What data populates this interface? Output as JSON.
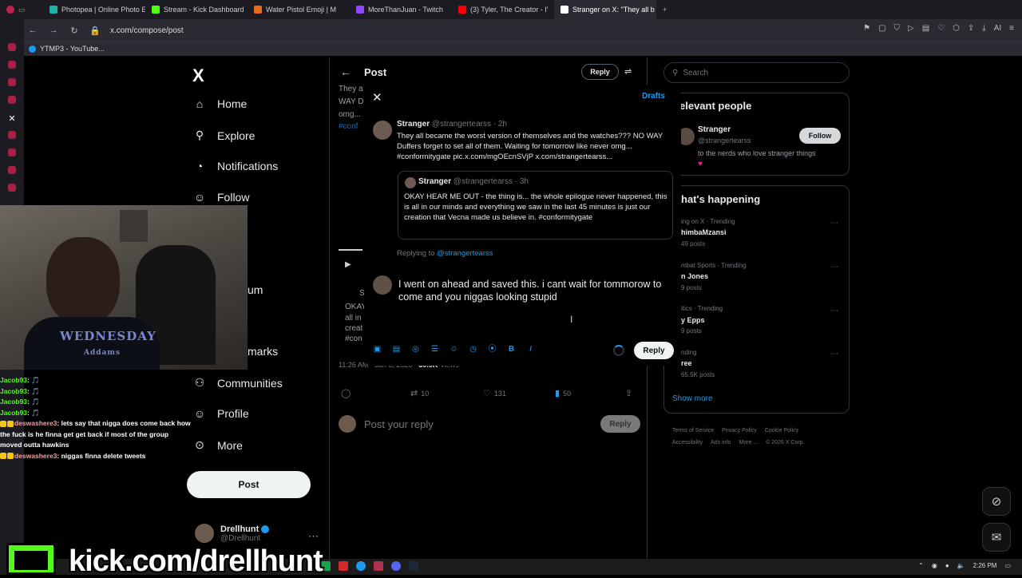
{
  "browser": {
    "tabs": [
      {
        "label": "Photopea | Online Photo E",
        "color": "#1fb0a8"
      },
      {
        "label": "Stream - Kick Dashboard",
        "color": "#53fc18"
      },
      {
        "label": "Water Pistol Emoji | M",
        "color": "#e86a1c"
      },
      {
        "label": "MoreThanJuan - Twitch",
        "color": "#9146ff"
      },
      {
        "label": "(3) Tyler, The Creator - I'",
        "color": "#ff0000"
      },
      {
        "label": "Stranger on X: \"They all b",
        "color": "#ffffff"
      }
    ],
    "url": "x.com/compose/post",
    "bookmark": "YTMP3 - YouTube..."
  },
  "nav": {
    "logo": "X",
    "items": [
      {
        "label": "Home",
        "icon": "⌂"
      },
      {
        "label": "Explore",
        "icon": "⚲"
      },
      {
        "label": "Notifications",
        "icon": "🔔"
      },
      {
        "label": "Follow",
        "icon": "👤"
      },
      {
        "label": "Communities",
        "icon": "👥"
      },
      {
        "label": "Profile",
        "icon": "👤"
      },
      {
        "label": "More",
        "icon": "⋯"
      }
    ],
    "partial_labels": [
      "um",
      "marks"
    ],
    "post_button": "Post",
    "account": {
      "name": "Drellhunt",
      "handle": "@Drellhunt"
    }
  },
  "center": {
    "title": "Post",
    "reply_button": "Reply",
    "bg_fragments": [
      "They a",
      "WAY D",
      "omg...",
      "#conf",
      "OKAY",
      "all in",
      "creat",
      "#con",
      "S"
    ],
    "stats": {
      "time": "11:26 AM · Jan 6, 2026 · ",
      "views": "30.9K",
      "views_label": " Views"
    },
    "actions": {
      "replies": "",
      "reposts": "10",
      "likes": "131",
      "bookmarks": "50"
    },
    "reply_placeholder": "Post your reply",
    "reply_dim_button": "Reply"
  },
  "modal": {
    "drafts": "Drafts",
    "tweet": {
      "name": "Stranger",
      "handle": "@strangertearss",
      "time": "· 2h",
      "text": "They all became the worst version of themselves and the watches??? NO WAY Duffers forget to set all of them. Waiting for tomorrow like never omg... #conformitygate pic.x.com/mgOEcnSVjP x.com/strangertearss..."
    },
    "quote": {
      "name": "Stranger",
      "handle": "@strangertearss",
      "time": "· 3h",
      "text": "OKAY HEAR ME OUT - the thing is... the whole epilogue never happened, this is all in our minds and everything we saw in the last 45 minutes is just our creation that Vecna made us believe in. #conformitygate"
    },
    "replying_to": "Replying to ",
    "replying_handle": "@strangertearss",
    "compose_text": "I went on ahead and saved this. i cant wait for tommorow to come and you niggas looking stupid",
    "reply_button": "Reply"
  },
  "right": {
    "search_placeholder": "Search",
    "relevant_title": "elevant people",
    "relevant": {
      "name": "Stranger",
      "handle": "@strangertearss",
      "bio": "to the nerds who love stranger things",
      "follow": "Follow"
    },
    "happening_title": "hat's happening",
    "trends": [
      {
        "ctx": "ing on X · Trending",
        "name": "himbaMzansi",
        "count": "49 posts"
      },
      {
        "ctx": "mbat Sports · Trending",
        "name": "n Jones",
        "count": "9 posts"
      },
      {
        "ctx": "itics · Trending",
        "name": "y Epps",
        "count": "9 posts"
      },
      {
        "ctx": "nding",
        "name": "ree",
        "count": "65.5K posts"
      }
    ],
    "show_more": "Show more",
    "footer": [
      "Terms of Service",
      "Privacy Policy",
      "Cookie Policy",
      "Accessibility",
      "Ads info",
      "More ...",
      "© 2026 X Corp."
    ]
  },
  "webcam": {
    "shirt_text": "WEDNESDAY",
    "shirt_sub": "Addams"
  },
  "chat": [
    {
      "user": "Jacob93",
      "msg": ": 🎵"
    },
    {
      "user": "Jacob93",
      "msg": ": 🎵"
    },
    {
      "user": "Jacob93",
      "msg": ": 🎵"
    },
    {
      "user": "Jacob93",
      "msg": ": 🎵"
    },
    {
      "user": "deswashere3",
      "msg": ": lets say that nigga does come back how the fuck is he finna get get back if most of the group moved outta hawkins"
    },
    {
      "user": "deswashere3",
      "msg": ": niggas finna delete tweets"
    }
  ],
  "overlay": {
    "kick_url": "kick.com/drellhunt"
  },
  "taskbar": {
    "clock": "2:26 PM"
  }
}
